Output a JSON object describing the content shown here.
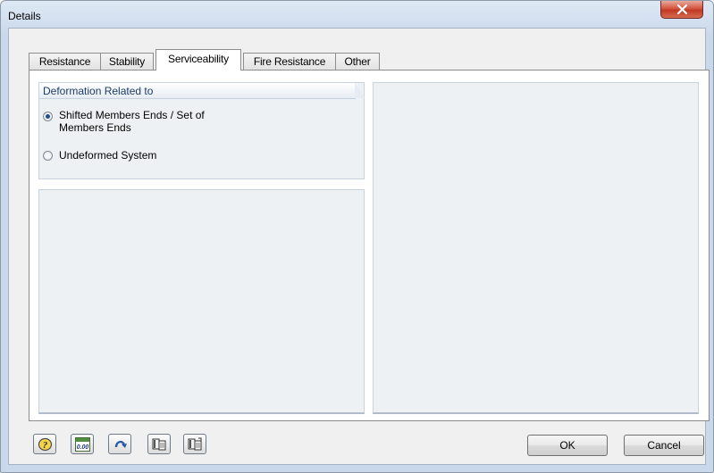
{
  "window": {
    "title": "Details"
  },
  "tabs": [
    {
      "label": "Resistance"
    },
    {
      "label": "Stability"
    },
    {
      "label": "Serviceability"
    },
    {
      "label": "Fire Resistance"
    },
    {
      "label": "Other"
    }
  ],
  "active_tab": "Serviceability",
  "deformation_group": {
    "title": "Deformation Related to",
    "options": [
      {
        "line1": "Shifted Members Ends / Set of",
        "line2": "Members Ends",
        "selected": true
      },
      {
        "line1": "Undeformed System",
        "line2": "",
        "selected": false
      }
    ]
  },
  "toolbar": {
    "icons": [
      "help-icon",
      "decimal-places-icon",
      "reset-default-icon",
      "import-icon",
      "export-icon"
    ],
    "decimal_icon_text": "0.00"
  },
  "buttons": {
    "ok": "OK",
    "cancel": "Cancel"
  },
  "colors": {
    "close_button": "#c13a23",
    "radio_dot": "#1f4e8c",
    "group_title": "#1e3d66"
  }
}
